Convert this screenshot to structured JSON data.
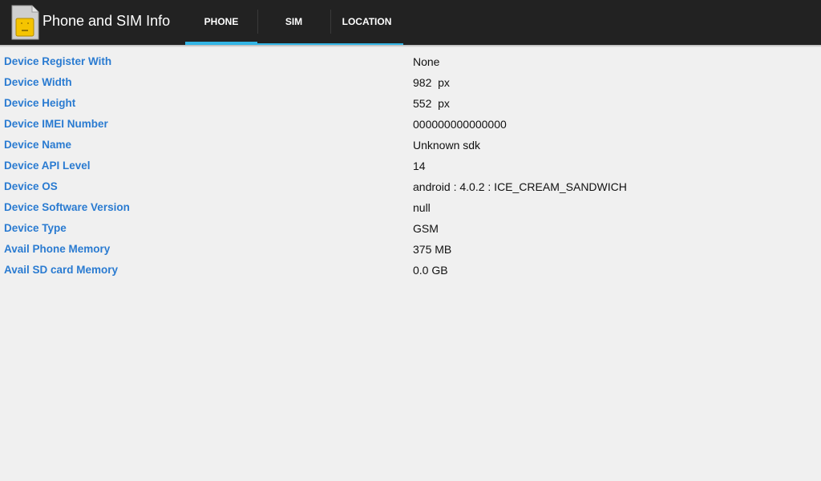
{
  "app": {
    "title": "Phone and SIM Info",
    "icon": "sim-card-icon"
  },
  "colors": {
    "action_bar": "#222222",
    "tab_indicator": "#33b5e5",
    "label_blue": "#2a7bd1",
    "background": "#f0f0f0",
    "icon_yellow": "#f5c400"
  },
  "tabs": [
    {
      "label": "PHONE",
      "selected": true
    },
    {
      "label": "SIM",
      "selected": false
    },
    {
      "label": "LOCATION",
      "selected": false
    }
  ],
  "rows": [
    {
      "label": "Device Register With",
      "value": "None"
    },
    {
      "label": "Device Width",
      "value": "982  px"
    },
    {
      "label": "Device Height",
      "value": "552  px"
    },
    {
      "label": "Device IMEI Number",
      "value": "000000000000000"
    },
    {
      "label": "Device Name",
      "value": "Unknown sdk"
    },
    {
      "label": "Device API Level",
      "value": "14"
    },
    {
      "label": "Device OS",
      "value": "android : 4.0.2 : ICE_CREAM_SANDWICH"
    },
    {
      "label": "Device Software Version",
      "value": "null"
    },
    {
      "label": "Device Type",
      "value": "GSM"
    },
    {
      "label": "Avail Phone Memory",
      "value": "375 MB"
    },
    {
      "label": "Avail SD card Memory",
      "value": "0.0 GB"
    }
  ]
}
